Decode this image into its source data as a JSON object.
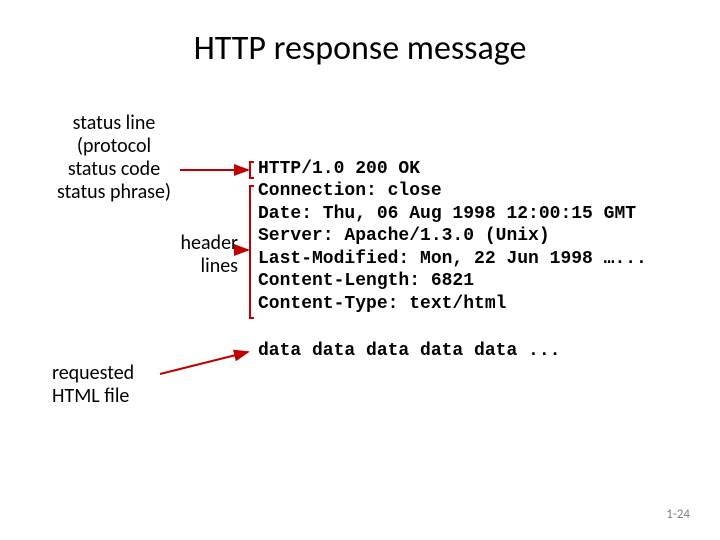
{
  "title_prefix": "HTTP response",
  "title_suffix": " message",
  "labels": {
    "status": "status line\n(protocol\nstatus code\nstatus phrase)",
    "header": "header\nlines",
    "requested": "requested\nHTML file"
  },
  "response": {
    "status_line": "HTTP/1.0 200 OK",
    "headers": "Connection: close\nDate: Thu, 06 Aug 1998 12:00:15 GMT\nServer: Apache/1.3.0 (Unix)\nLast-Modified: Mon, 22 Jun 1998 …...\nContent-Length: 6821\nContent-Type: text/html",
    "data": "data data data data data ..."
  },
  "page_num": "1-24"
}
